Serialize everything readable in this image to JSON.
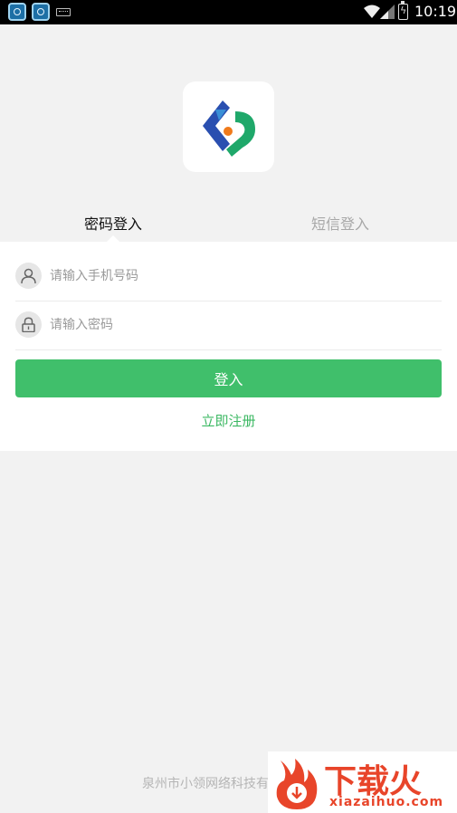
{
  "status_bar": {
    "time": "10:19"
  },
  "tabs": {
    "password_login": "密码登入",
    "sms_login": "短信登入"
  },
  "form": {
    "phone_placeholder": "请输入手机号码",
    "password_placeholder": "请输入密码",
    "login_button": "登入",
    "register_link": "立即注册"
  },
  "footer": {
    "company": "泉州市小领网络科技有"
  },
  "watermark": {
    "brand": "下载火",
    "domain": "xiazaihuo.com"
  },
  "colors": {
    "accent_green": "#40bf6b",
    "logo_blue": "#2a4fb0",
    "logo_green": "#1fa86a",
    "logo_orange": "#f07a1a"
  }
}
